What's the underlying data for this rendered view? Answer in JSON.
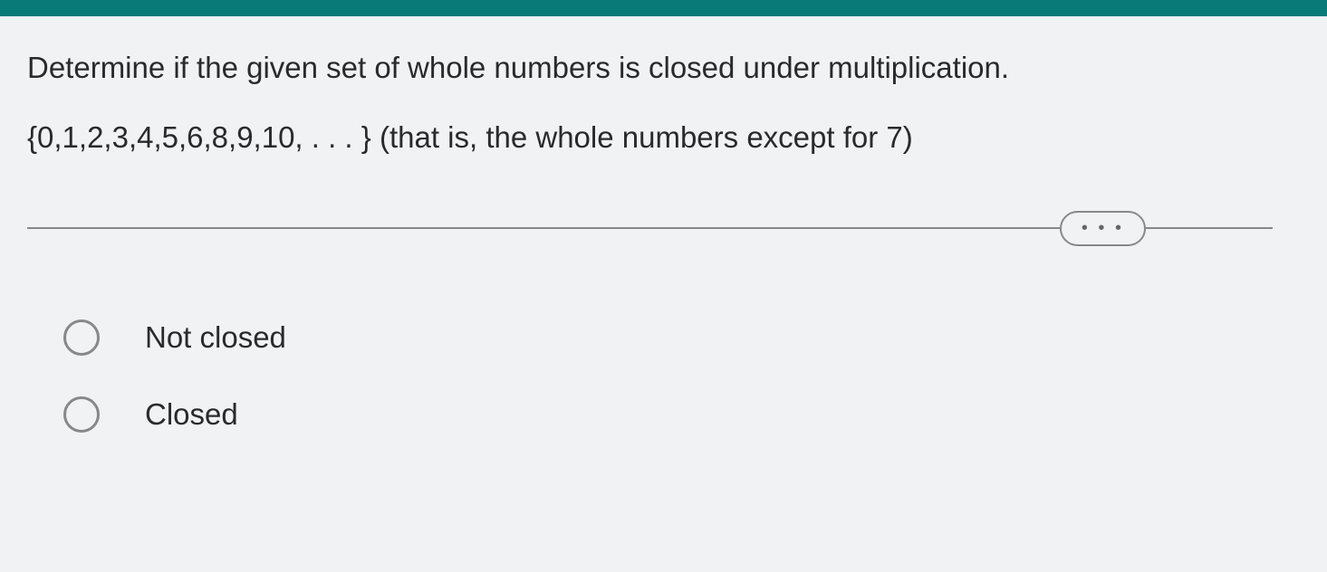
{
  "question": {
    "prompt": "Determine if the given set of whole numbers is closed under multiplication.",
    "set_expression": "{0,1,2,3,4,5,6,8,9,10, . . . } (that is, the whole numbers except for 7)"
  },
  "more_button": "• • •",
  "options": [
    {
      "label": "Not closed"
    },
    {
      "label": "Closed"
    }
  ]
}
